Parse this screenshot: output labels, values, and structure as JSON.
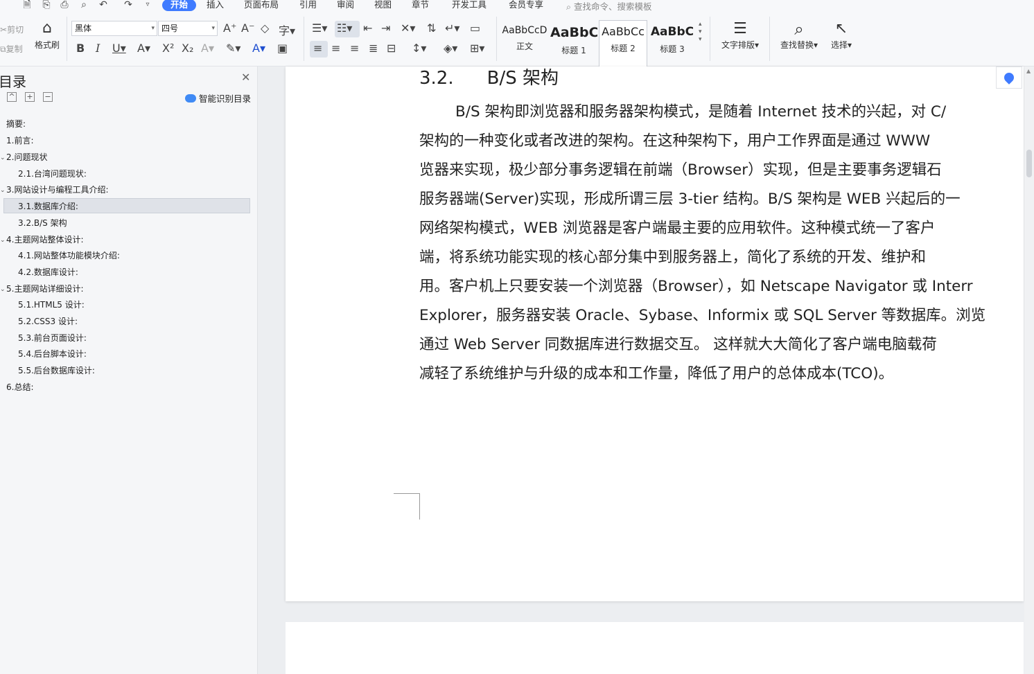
{
  "menu": {
    "tabs": [
      "开始",
      "插入",
      "页面布局",
      "引用",
      "审阅",
      "视图",
      "章节",
      "开发工具",
      "会员专享"
    ],
    "active_tab": "开始",
    "search_placeholder": "查找命令、搜索模板"
  },
  "ribbon": {
    "cut": "剪切",
    "copy": "复制",
    "format_painter": "格式刷",
    "font_name": "黑体",
    "font_size": "四号",
    "styles": [
      {
        "preview": "AaBbCcD",
        "label": "正文"
      },
      {
        "preview": "AaBbC",
        "label": "标题 1"
      },
      {
        "preview": "AaBbCc",
        "label": "标题 2"
      },
      {
        "preview": "AaBbC",
        "label": "标题 3"
      }
    ],
    "text_layout": "文字排版",
    "find_replace": "查找替换",
    "select": "选择"
  },
  "sidebar": {
    "title": "目录",
    "smart_toc": "智能识别目录",
    "items": [
      {
        "label": "摘要:",
        "level": 1
      },
      {
        "label": "1.前言:",
        "level": 1
      },
      {
        "label": "2.问题现状",
        "level": 1
      },
      {
        "label": "2.1.台湾问题现状:",
        "level": 2
      },
      {
        "label": "3.网站设计与编程工具介绍:",
        "level": 1
      },
      {
        "label": "3.1.数据库介绍:",
        "level": 2
      },
      {
        "label": "3.2.B/S 架构",
        "level": 2
      },
      {
        "label": "4.主题网站整体设计:",
        "level": 1
      },
      {
        "label": "4.1.网站整体功能模块介绍:",
        "level": 2
      },
      {
        "label": "4.2.数据库设计:",
        "level": 2
      },
      {
        "label": "5.主题网站详细设计:",
        "level": 1
      },
      {
        "label": "5.1.HTML5 设计:",
        "level": 2
      },
      {
        "label": "5.2.CSS3 设计:",
        "level": 2
      },
      {
        "label": "5.3.前台页面设计:",
        "level": 2
      },
      {
        "label": "5.4.后台脚本设计:",
        "level": 2
      },
      {
        "label": "5.5.后台数据库设计:",
        "level": 2
      },
      {
        "label": "6.总结:",
        "level": 1
      }
    ],
    "selected": "3.1.数据库介绍:"
  },
  "document": {
    "heading_number": "3.2.",
    "heading_text": "B/S 架构",
    "lines": [
      "B/S 架构即浏览器和服务器架构模式，是随着 Internet 技术的兴起，对 C/",
      "架构的一种变化或者改进的架构。在这种架构下，用户工作界面是通过 WWW",
      "览器来实现，极少部分事务逻辑在前端（Browser）实现，但是主要事务逻辑石",
      "服务器端(Server)实现，形成所谓三层 3-tier 结构。B/S 架构是 WEB 兴起后的一",
      "网络架构模式，WEB 浏览器是客户端最主要的应用软件。这种模式统一了客户",
      "端，将系统功能实现的核心部分集中到服务器上，简化了系统的开发、维护和",
      "用。客户机上只要安装一个浏览器（Browser），如 Netscape Navigator 或 Interr",
      "Explorer，服务器安装 Oracle、Sybase、Informix 或  SQL Server 等数据库。浏览",
      "通过 Web Server 同数据库进行数据交互。 这样就大大简化了客户端电脑载荷",
      "减轻了系统维护与升级的成本和工作量，降低了用户的总体成本(TCO)。"
    ]
  }
}
